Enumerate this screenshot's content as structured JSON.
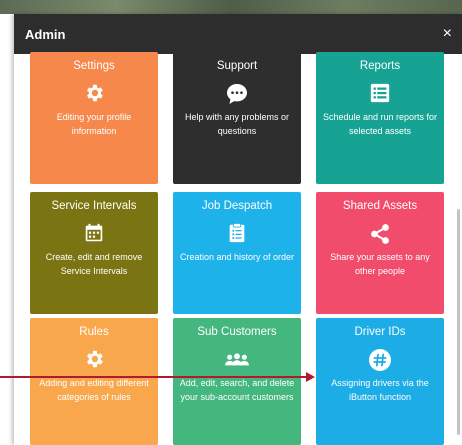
{
  "modal": {
    "title": "Admin",
    "close_symbol": "×"
  },
  "tiles": [
    {
      "title": "Settings",
      "icon": "gear-icon",
      "description": "Editing your profile information",
      "color": "#f5884a"
    },
    {
      "title": "Support",
      "icon": "chat-bubble-icon",
      "description": "Help with any problems or questions",
      "color": "#2e2e2e"
    },
    {
      "title": "Reports",
      "icon": "list-icon",
      "description": "Schedule and run reports for selected assets",
      "color": "#17a394"
    },
    {
      "title": "Service Intervals",
      "icon": "calendar-icon",
      "description": "Create, edit and remove Service Intervals",
      "color": "#7b7412"
    },
    {
      "title": "Job Despatch",
      "icon": "clipboard-icon",
      "description": "Creation and history of order",
      "color": "#1eb2eb"
    },
    {
      "title": "Shared Assets",
      "icon": "share-icon",
      "description": "Share your assets to any other people",
      "color": "#f24c6d"
    },
    {
      "title": "Rules",
      "icon": "gear-icon",
      "description": "Adding and editing different categories of rules",
      "color": "#f9a74c"
    },
    {
      "title": "Sub Customers",
      "icon": "users-icon",
      "description": "Add, edit, search, and delete your sub-account customers",
      "color": "#43b77e"
    },
    {
      "title": "Driver IDs",
      "icon": "hash-icon",
      "description": "Assigning drivers via the iButton function",
      "color": "#1cace6"
    }
  ],
  "annotation": {
    "color": "#b11a2a",
    "points_to": "Driver IDs"
  }
}
